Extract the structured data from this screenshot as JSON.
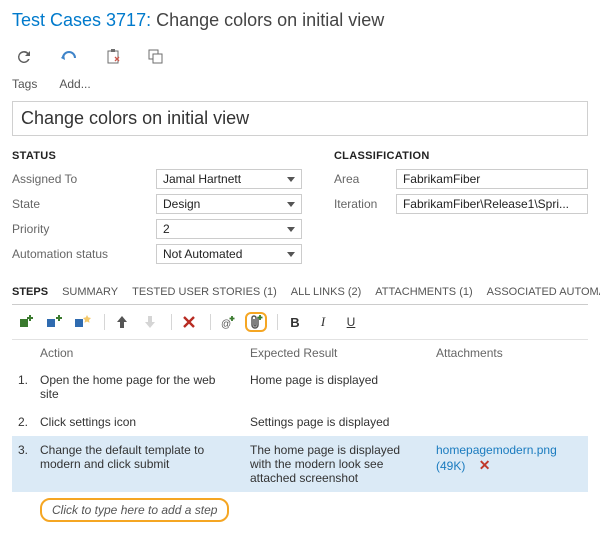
{
  "header": {
    "prefix": "Test Cases 3717:",
    "title": "Change colors on initial view"
  },
  "tags": {
    "label": "Tags",
    "add": "Add..."
  },
  "name_value": "Change colors on initial view",
  "status": {
    "heading": "STATUS",
    "assigned_to": {
      "label": "Assigned To",
      "value": "Jamal Hartnett"
    },
    "state": {
      "label": "State",
      "value": "Design"
    },
    "priority": {
      "label": "Priority",
      "value": "2"
    },
    "automation": {
      "label": "Automation status",
      "value": "Not Automated"
    }
  },
  "classification": {
    "heading": "CLASSIFICATION",
    "area": {
      "label": "Area",
      "value": "FabrikamFiber"
    },
    "iteration": {
      "label": "Iteration",
      "value": "FabrikamFiber\\Release1\\Spri..."
    }
  },
  "tabs": {
    "steps": "STEPS",
    "summary": "SUMMARY",
    "tested": "TESTED USER STORIES (1)",
    "links": "ALL LINKS (2)",
    "attachments": "ATTACHMENTS (1)",
    "associated": "ASSOCIATED AUTOMAT..."
  },
  "grid": {
    "col_action": "Action",
    "col_expected": "Expected Result",
    "col_attach": "Attachments"
  },
  "steps": [
    {
      "num": "1.",
      "action": "Open the home page for the web site",
      "expected": "Home page is displayed",
      "attach": ""
    },
    {
      "num": "2.",
      "action": "Click settings icon",
      "expected": "Settings page is displayed",
      "attach": ""
    },
    {
      "num": "3.",
      "action": "Change the default template to modern and click submit",
      "expected": "The home page is displayed with the modern look see attached screenshot",
      "attach": "homepagemodern.png (49K)"
    }
  ],
  "add_step_placeholder": "Click to type here to add a step"
}
